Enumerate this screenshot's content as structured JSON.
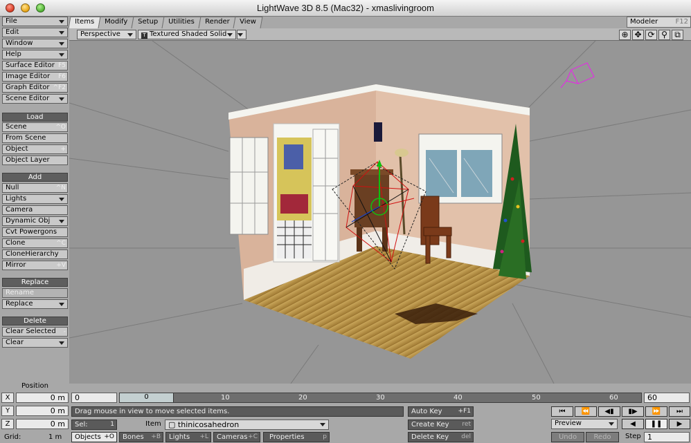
{
  "window": {
    "title": "LightWave 3D 8.5 (Mac32) - xmaslivingroom"
  },
  "tabs": [
    {
      "label": "Items"
    },
    {
      "label": "Modify"
    },
    {
      "label": "Setup"
    },
    {
      "label": "Utilities"
    },
    {
      "label": "Render"
    },
    {
      "label": "View"
    }
  ],
  "modeler": {
    "label": "Modeler",
    "key": "F12"
  },
  "sidebar": {
    "menus": [
      {
        "label": "File"
      },
      {
        "label": "Edit"
      },
      {
        "label": "Window"
      },
      {
        "label": "Help"
      }
    ],
    "editors": [
      {
        "label": "Surface Editor",
        "key": "F5"
      },
      {
        "label": "Image Editor",
        "key": "F6"
      },
      {
        "label": "Graph Editor",
        "key": "^F2"
      },
      {
        "label": "Scene Editor"
      }
    ],
    "load": {
      "heading": "Load",
      "items": [
        {
          "label": "Scene",
          "key": "^O"
        },
        {
          "label": "From Scene"
        },
        {
          "label": "Object",
          "key": "+"
        },
        {
          "label": "Object Layer"
        }
      ]
    },
    "add": {
      "heading": "Add",
      "items": [
        {
          "label": "Null",
          "key": "^N"
        },
        {
          "label": "Lights"
        },
        {
          "label": "Camera"
        },
        {
          "label": "Dynamic Obj"
        },
        {
          "label": "Cvt Powergons"
        },
        {
          "label": "Clone",
          "key": "^C"
        },
        {
          "label": "CloneHierarchy"
        },
        {
          "label": "Mirror",
          "key": "+V"
        }
      ]
    },
    "replace": {
      "heading": "Replace",
      "items": [
        {
          "label": "Rename"
        },
        {
          "label": "Replace"
        }
      ]
    },
    "delete": {
      "heading": "Delete",
      "items": [
        {
          "label": "Clear Selected",
          "key": "-"
        },
        {
          "label": "Clear"
        }
      ]
    }
  },
  "viewport": {
    "view_mode": "Perspective",
    "render_mode": "Textured Shaded Solid",
    "render_icon": "T"
  },
  "position": {
    "label": "Position",
    "x_label": "X",
    "x_value": "0 m",
    "y_label": "Y",
    "y_value": "0 m",
    "z_label": "Z",
    "z_value": "0 m",
    "grid_label": "Grid:",
    "grid_value": "1 m"
  },
  "timeline": {
    "start": "0",
    "current": "0",
    "end": "60",
    "ticks": [
      "10",
      "20",
      "30",
      "40",
      "50",
      "60"
    ]
  },
  "status": {
    "message": "Drag mouse in view to move selected items."
  },
  "selection": {
    "sel_label": "Sel:",
    "sel_value": "1",
    "item_label": "Item",
    "item_value": "thinicosahedron"
  },
  "item_types": [
    {
      "label": "Objects",
      "key": "+O"
    },
    {
      "label": "Bones",
      "key": "+B"
    },
    {
      "label": "Lights",
      "key": "+L"
    },
    {
      "label": "Cameras",
      "key": "+C"
    },
    {
      "label": "Properties",
      "key": "p"
    }
  ],
  "keys": {
    "auto_key": "Auto Key",
    "auto_key_shortcut": "+F1",
    "create_key": "Create Key",
    "create_key_shortcut": "ret",
    "delete_key": "Delete Key",
    "delete_key_shortcut": "del"
  },
  "transport": {
    "preview": "Preview",
    "undo": "Undo",
    "redo": "Redo",
    "step_label": "Step",
    "step_value": "1"
  }
}
